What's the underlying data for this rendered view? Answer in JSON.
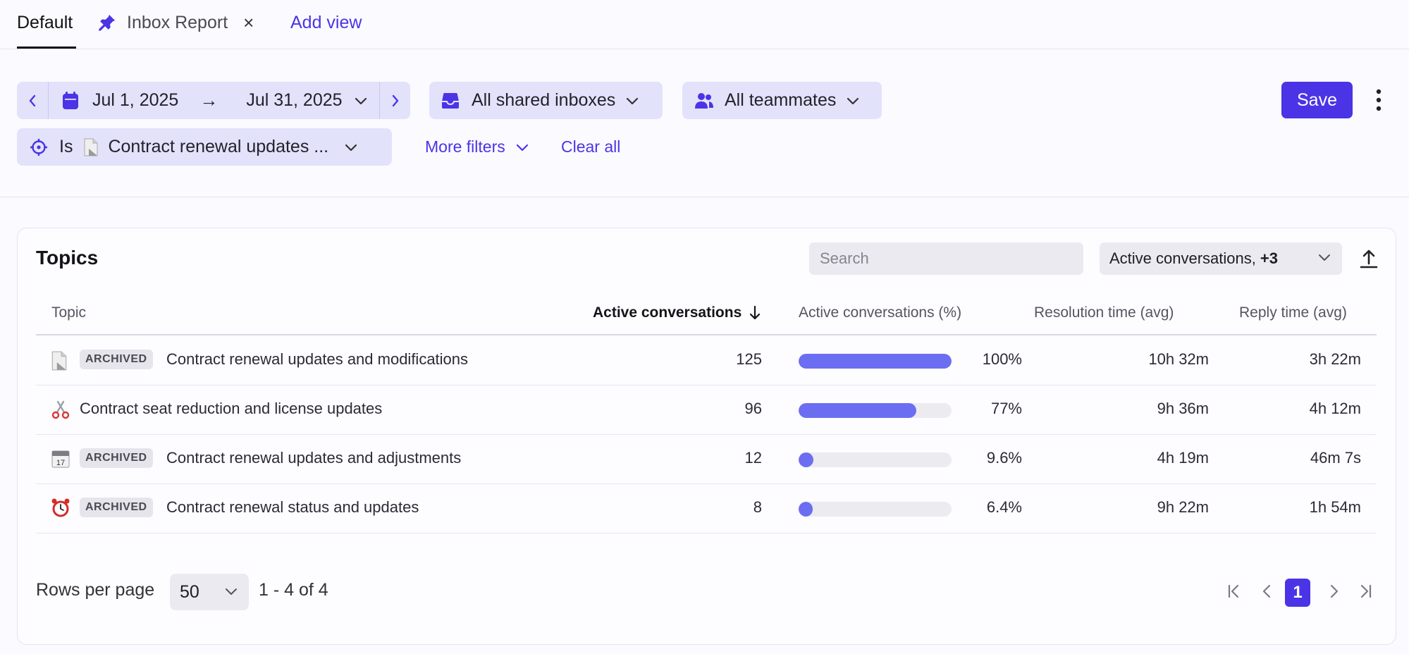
{
  "tabs": {
    "default_label": "Default",
    "inbox_report_label": "Inbox Report",
    "close_symbol": "×",
    "add_view_label": "Add view"
  },
  "filters": {
    "date_start": "Jul 1, 2025",
    "date_arrow": "→",
    "date_end": "Jul 31, 2025",
    "inboxes_label": "All shared inboxes",
    "teammates_label": "All teammates",
    "topic_filter_prefix": "Is",
    "topic_filter_value": "Contract renewal updates ...",
    "more_filters_label": "More filters",
    "clear_all_label": "Clear all",
    "save_label": "Save"
  },
  "topics_card": {
    "title": "Topics",
    "search_placeholder": "Search",
    "column_selector": {
      "text": "Active conversations,",
      "extra": "+3"
    },
    "columns": {
      "topic": "Topic",
      "active": "Active conversations",
      "active_pct": "Active conversations (%)",
      "resolution": "Resolution time (avg)",
      "reply": "Reply time (avg)"
    },
    "rows": [
      {
        "icon": "document-page-icon",
        "archived": "ARCHIVED",
        "topic": "Contract renewal updates and modifications",
        "active": "125",
        "pct_label": "100%",
        "pct_value": 100,
        "resolution": "10h 32m",
        "reply": "3h 22m"
      },
      {
        "icon": "scissors-icon",
        "archived": "",
        "topic": "Contract seat reduction and license updates",
        "active": "96",
        "pct_label": "77%",
        "pct_value": 77,
        "resolution": "9h 36m",
        "reply": "4h 12m"
      },
      {
        "icon": "calendar-icon",
        "archived": "ARCHIVED",
        "topic": "Contract renewal updates and adjustments",
        "active": "12",
        "pct_label": "9.6%",
        "pct_value": 9.6,
        "resolution": "4h 19m",
        "reply": "46m 7s"
      },
      {
        "icon": "alarm-clock-icon",
        "archived": "ARCHIVED",
        "topic": "Contract renewal status and updates",
        "active": "8",
        "pct_label": "6.4%",
        "pct_value": 6.4,
        "resolution": "9h 22m",
        "reply": "1h 54m"
      }
    ],
    "pagination": {
      "rows_per_page_label": "Rows per page",
      "rows_per_page_value": "50",
      "range_label": "1 - 4 of 4",
      "current_page": "1"
    }
  },
  "colors": {
    "accent": "#4b34e6",
    "chip_bg": "#e3e2fb",
    "bar_fill": "#6c6ef2",
    "bar_track": "#ecebf0",
    "page_bg": "#fbfaff"
  }
}
